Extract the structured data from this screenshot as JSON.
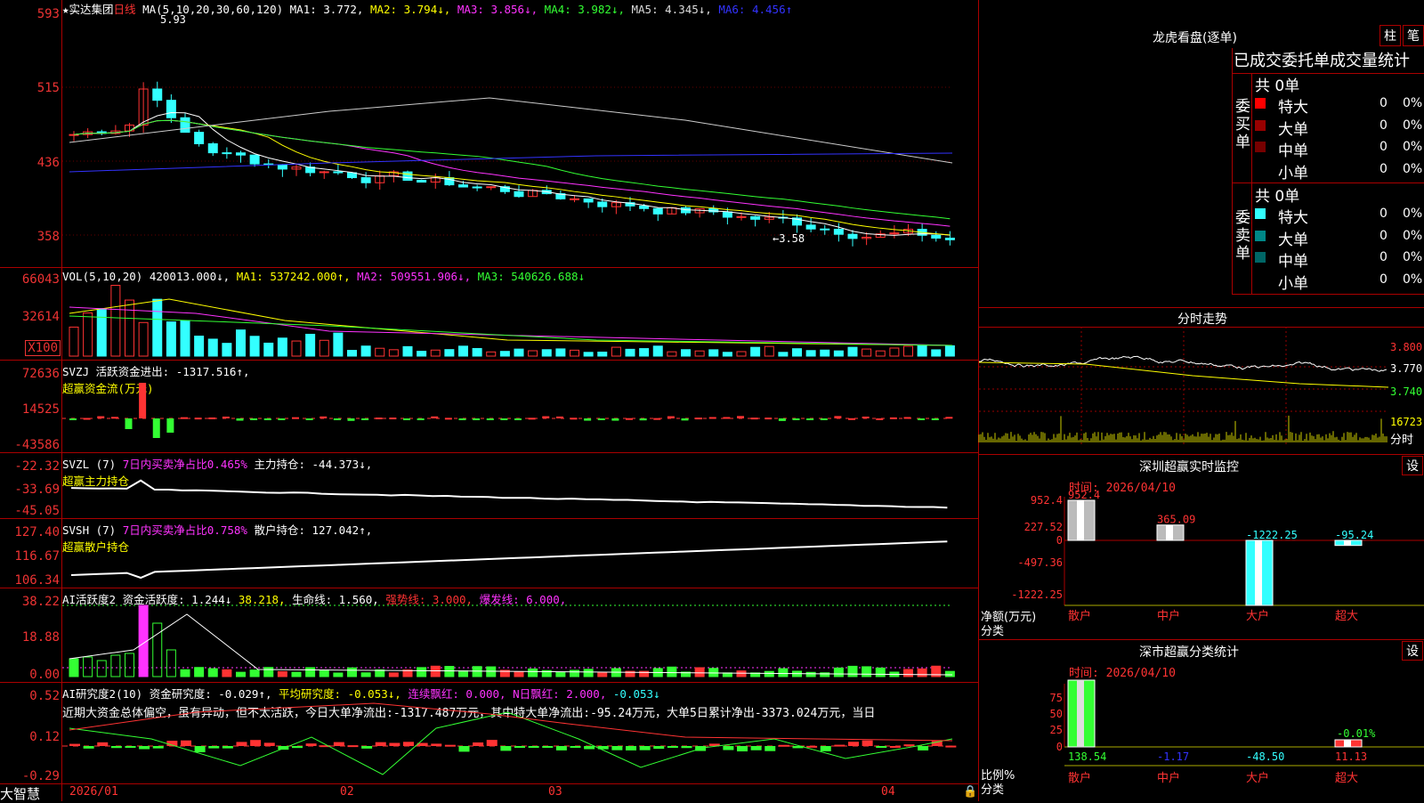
{
  "stock": {
    "name": "★实达集团",
    "period": "日线",
    "ma_label": "MA(5,10,20,30,60,120)",
    "ma": [
      {
        "k": "MA1:",
        "v": "3.772,",
        "c": "#fff"
      },
      {
        "k": "MA2:",
        "v": "3.794↓,",
        "c": "#ff0"
      },
      {
        "k": "MA3:",
        "v": "3.856↓,",
        "c": "#f3f"
      },
      {
        "k": "MA4:",
        "v": "3.982↓,",
        "c": "#3f3"
      },
      {
        "k": "MA5:",
        "v": "4.345↓,",
        "c": "#ddd"
      },
      {
        "k": "MA6:",
        "v": "4.456↑",
        "c": "#33f"
      }
    ],
    "high_label": "5.93",
    "low_label": "←3.58"
  },
  "axes": {
    "price": [
      "593",
      "515",
      "436",
      "358"
    ],
    "vol": [
      "66043",
      "32614",
      "X100"
    ],
    "svzj": [
      "72636",
      "14525",
      "-43586"
    ],
    "svzl": [
      "-22.32",
      "-33.69",
      "-45.05"
    ],
    "svsh": [
      "127.40",
      "116.67",
      "106.34"
    ],
    "ai1": [
      "38.22",
      "18.88",
      "0.00"
    ],
    "ai2": [
      "0.52",
      "0.12",
      "-0.29"
    ]
  },
  "vol_hdr": {
    "name": "VOL(5,10,20)",
    "v": "420013.000↓,",
    "ma1": "MA1: 537242.000↑,",
    "ma2": "MA2: 509551.906↓,",
    "ma3": "MA3: 540626.688↓"
  },
  "svzj_hdr": {
    "name": "SVZJ",
    "k": "活跃资金进出:",
    "v": "-1317.516↑,",
    "sub": "超赢资金流(万元)"
  },
  "svzl_hdr": {
    "name": "SVZL (7)",
    "k1": "7日内买卖净占比0.465%",
    "k2": "主力持仓:",
    "v": "-44.373↓,",
    "sub": "超赢主力持仓"
  },
  "svsh_hdr": {
    "name": "SVSH (7)",
    "k1": "7日内买卖净占比0.758%",
    "k2": "散户持仓:",
    "v": "127.042↑,",
    "sub": "超赢散户持仓"
  },
  "ai1_hdr": {
    "name": "AI活跃度2",
    "k": "资金活跃度:",
    "v": "1.244↓",
    "v2": "38.218,",
    "k3": "生命线:",
    "v3": "1.560,",
    "k4": "强势线: 3.000,",
    "k5": "爆发线: 6.000,"
  },
  "ai2_hdr": {
    "name": "AI研究度2(10)",
    "k": "资金研究度:",
    "v": "-0.029↑,",
    "k2": "平均研究度:",
    "v2": "-0.053↓,",
    "k3": "连续飘红: 0.000,",
    "k4": "N日飘红:",
    "v4": "2.000,",
    "v5": "-0.053↓",
    "text": "近期大资金总体偏空，虽有异动，但不太活跃，今日大单净流出:-1317.487万元，其中特大单净流出:-95.24万元，大单5日累计净出-3373.024万元，当日"
  },
  "xaxis": [
    "2026/01",
    "02",
    "03",
    "04"
  ],
  "brand": "大智慧",
  "right": {
    "lhb": {
      "title": "龙虎看盘(逐单)",
      "b1": "柱",
      "b2": "笔",
      "sub": "已成交委托单成交量统计",
      "buy": {
        "label": "委买单",
        "total": "共 0单",
        "rows": [
          {
            "n": "特大",
            "v": "0",
            "p": "0%",
            "c": "#ff0000"
          },
          {
            "n": "大单",
            "v": "0",
            "p": "0%",
            "c": "#990000"
          },
          {
            "n": "中单",
            "v": "0",
            "p": "0%",
            "c": "#770000"
          },
          {
            "n": "小单",
            "v": "0",
            "p": "0%",
            "c": "#000"
          }
        ]
      },
      "sell": {
        "label": "委卖单",
        "total": "共 0单",
        "rows": [
          {
            "n": "特大",
            "v": "0",
            "p": "0%",
            "c": "#33ffff"
          },
          {
            "n": "大单",
            "v": "0",
            "p": "0%",
            "c": "#008888"
          },
          {
            "n": "中单",
            "v": "0",
            "p": "0%",
            "c": "#006666"
          },
          {
            "n": "小单",
            "v": "0",
            "p": "0%",
            "c": "#000"
          }
        ]
      }
    },
    "fenshi": {
      "title": "分时走势",
      "p1": "3.800",
      "p2": "3.770",
      "p3": "3.740",
      "vol": "16723",
      "vlab": "分时"
    },
    "sz": {
      "title": "深圳超赢实时监控",
      "btn": "设",
      "time": "时间: 2026/04/10",
      "ax": [
        "952.4",
        "227.52",
        "0",
        "-497.36",
        "-1222.25"
      ],
      "vals": [
        {
          "l": "952.4",
          "c": "#ff3333"
        },
        {
          "l": "365.09",
          "c": "#ff3333"
        },
        {
          "l": "-1222.25",
          "c": "#33ffff"
        },
        {
          "l": "-95.24",
          "c": "#33ffff"
        }
      ],
      "ylab": "净额(万元)",
      "xlab": "分类",
      "cats": [
        "散户",
        "中户",
        "大户",
        "超大"
      ]
    },
    "cls": {
      "title": "深市超赢分类统计",
      "btn": "设",
      "time": "时间: 2026/04/10",
      "ax": [
        "75",
        "50",
        "25",
        "0"
      ],
      "top": "-0.01%",
      "vals": [
        "138.54",
        "-1.17",
        "-48.50",
        "11.13"
      ],
      "valc": [
        "#33ff33",
        "#3333ff",
        "#33ffff",
        "#ff3333"
      ],
      "ylab": "比例%",
      "xlab": "分类",
      "cats": [
        "散户",
        "中户",
        "大户",
        "超大"
      ]
    }
  }
}
